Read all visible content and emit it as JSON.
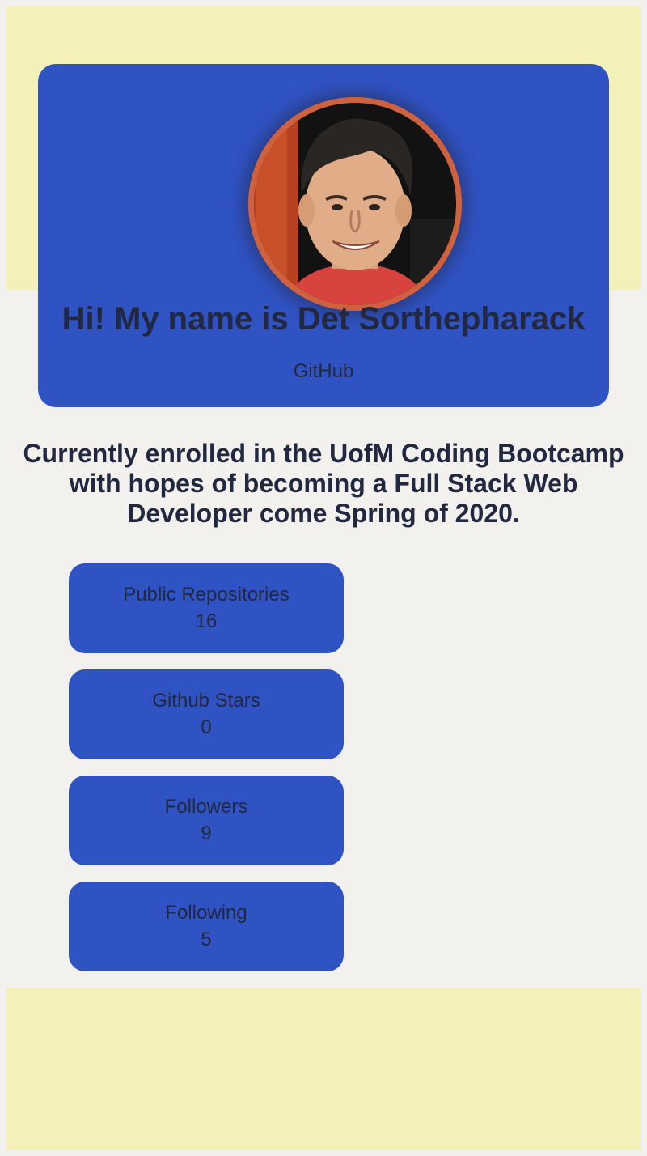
{
  "profile": {
    "name_heading": "Hi! My name is Det Sorthepharack",
    "github_link": "GitHub",
    "avatar_alt": "Det Sorthepharack"
  },
  "bio": "Currently enrolled in the UofM Coding Bootcamp with hopes of becoming a Full Stack Web Developer come Spring of 2020.",
  "stats": [
    {
      "label": "Public Repositories",
      "value": "16"
    },
    {
      "label": "Github Stars",
      "value": "0"
    },
    {
      "label": "Followers",
      "value": "9"
    },
    {
      "label": "Following",
      "value": "5"
    }
  ],
  "colors": {
    "background": "#f2f1ee",
    "band": "#f4f0b9",
    "card": "#3053c4",
    "text": "#222840",
    "avatar_border": "#d0613e"
  }
}
